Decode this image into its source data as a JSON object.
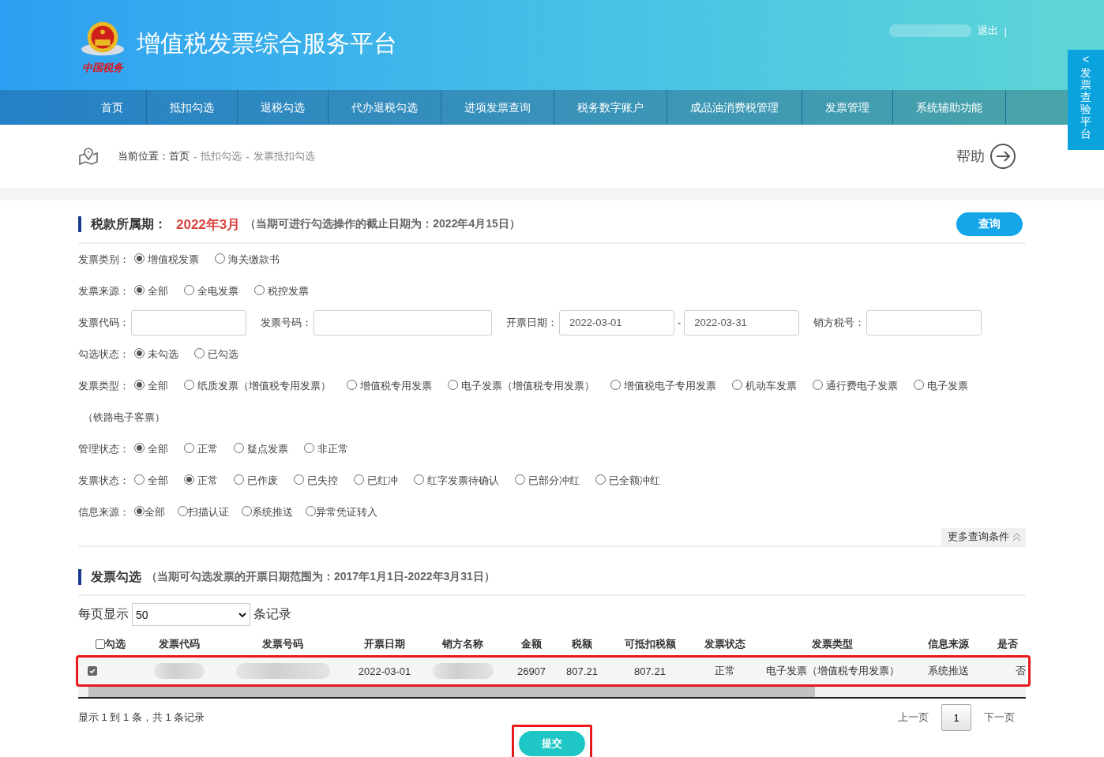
{
  "header": {
    "emblem_caption": "中国税务",
    "title": "增值税发票综合服务平台",
    "logout": "退出",
    "separator": "|"
  },
  "side_tab": {
    "arrow": "<",
    "label": "发票查验平台"
  },
  "nav": [
    "首页",
    "抵扣勾选",
    "退税勾选",
    "代办退税勾选",
    "进项发票查询",
    "税务数字账户",
    "成品油消费税管理",
    "发票管理",
    "系统辅助功能"
  ],
  "breadcrumb": {
    "prefix": "当前位置：",
    "items": [
      "首页",
      "抵扣勾选",
      "发票抵扣勾选"
    ],
    "separators": [
      "-",
      "-"
    ],
    "help": "帮助"
  },
  "query": {
    "title": "税款所属期：",
    "period": "2022年3月",
    "note": "（当期可进行勾选操作的截止日期为：2022年4月15日）",
    "button": "查询",
    "filters": [
      {
        "kind": "radio",
        "label": "发票类别：",
        "options": [
          {
            "label": "增值税发票",
            "selected": true
          },
          {
            "label": "海关缴款书",
            "selected": false
          }
        ]
      },
      {
        "kind": "radio",
        "label": "发票来源：",
        "options": [
          {
            "label": "全部",
            "selected": true
          },
          {
            "label": "全电发票",
            "selected": false
          },
          {
            "label": "税控发票",
            "selected": false
          }
        ]
      },
      {
        "kind": "fields",
        "items": [
          {
            "label": "发票代码："
          },
          {
            "label": "发票号码：",
            "wide": true
          },
          {
            "label": "开票日期：",
            "from": "2022-03-01",
            "separator": "-",
            "to": "2022-03-31"
          },
          {
            "label": "销方税号："
          }
        ]
      },
      {
        "kind": "radio",
        "label": "勾选状态：",
        "options": [
          {
            "label": "未勾选",
            "selected": true
          },
          {
            "label": "已勾选",
            "selected": false
          }
        ]
      },
      {
        "kind": "radio",
        "label": "发票类型：",
        "options": [
          {
            "label": "全部",
            "selected": true
          },
          {
            "label": "纸质发票（增值税专用发票）",
            "selected": false
          },
          {
            "label": "增值税专用发票",
            "selected": false
          },
          {
            "label": "电子发票（增值税专用发票）",
            "selected": false
          },
          {
            "label": "增值税电子专用发票",
            "selected": false
          },
          {
            "label": "机动车发票",
            "selected": false
          },
          {
            "label": "通行费电子发票",
            "selected": false
          },
          {
            "label": "电子发票",
            "continuation": "（铁路电子客票）",
            "selected": false
          }
        ]
      },
      {
        "kind": "radio",
        "label": "管理状态：",
        "options": [
          {
            "label": "全部",
            "selected": true
          },
          {
            "label": "正常",
            "selected": false
          },
          {
            "label": "疑点发票",
            "selected": false
          },
          {
            "label": "非正常",
            "selected": false
          }
        ]
      },
      {
        "kind": "radio",
        "label": "发票状态：",
        "options": [
          {
            "label": "全部",
            "selected": false
          },
          {
            "label": "正常",
            "selected": true
          },
          {
            "label": "已作废",
            "selected": false
          },
          {
            "label": "已失控",
            "selected": false
          },
          {
            "label": "已红冲",
            "selected": false
          },
          {
            "label": "红字发票待确认",
            "selected": false
          },
          {
            "label": "已部分冲红",
            "selected": false
          },
          {
            "label": "已全额冲红",
            "selected": false
          }
        ]
      },
      {
        "kind": "radio",
        "label": "信息来源：",
        "compact": true,
        "options": [
          {
            "label": "全部",
            "selected": true
          },
          {
            "label": "扫描认证",
            "selected": false
          },
          {
            "label": "系统推送",
            "selected": false
          },
          {
            "label": "异常凭证转入",
            "selected": false
          }
        ]
      }
    ],
    "more": "更多查询条件"
  },
  "selection": {
    "title": "发票勾选",
    "note": "（当期可勾选发票的开票日期范围为：2017年1月1日-2022年3月31日）",
    "page_size_prefix": "每页显示",
    "page_size": "50",
    "page_size_suffix": "条记录",
    "header_checked": false,
    "columns": [
      {
        "label": "勾选",
        "kind": "check"
      },
      {
        "label": "发票代码",
        "kind": "redacted"
      },
      {
        "label": "发票号码",
        "kind": "redacted"
      },
      {
        "label": "开票日期",
        "kind": "text"
      },
      {
        "label": "销方名称",
        "kind": "redacted"
      },
      {
        "label": "金额",
        "kind": "text"
      },
      {
        "label": "税额",
        "kind": "text"
      },
      {
        "label": "可抵扣税额",
        "kind": "text"
      },
      {
        "label": "发票状态",
        "kind": "text"
      },
      {
        "label": "发票类型",
        "kind": "text"
      },
      {
        "label": "信息来源",
        "kind": "text"
      },
      {
        "label": "是否",
        "kind": "text"
      }
    ],
    "rows": [
      {
        "selected": true,
        "cells": [
          "",
          "",
          "",
          "2022-03-01",
          "",
          "26907",
          "807.21",
          "807.21",
          "正常",
          "电子发票（增值税专用发票）",
          "系统推送",
          "否"
        ]
      }
    ],
    "info": "显示 1 到 1 条，共 1 条记录",
    "prev": "上一页",
    "page": "1",
    "next": "下一页",
    "submit": "提交"
  }
}
